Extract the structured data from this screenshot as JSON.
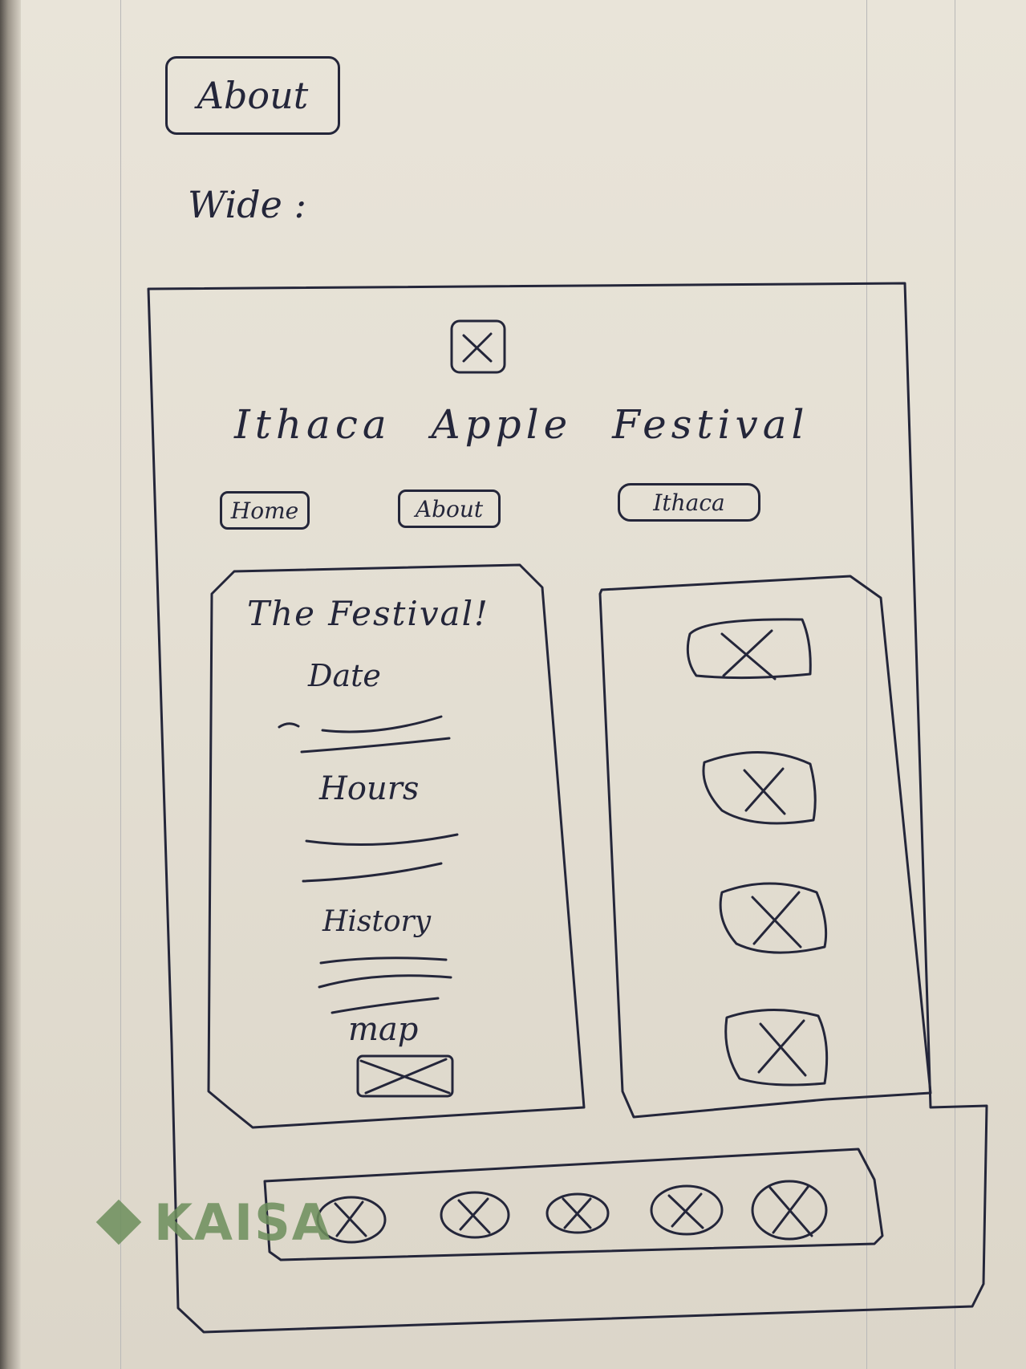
{
  "sketch": {
    "page_label": "About",
    "layout_label": "Wide :",
    "site_title": "Ithaca  Apple  Festival",
    "nav": {
      "home": "Home",
      "about": "About",
      "ithaca": "Ithaca"
    },
    "festival_panel": {
      "heading": "The Festival!",
      "date_label": "Date",
      "hours_label": "Hours",
      "history_label": "History",
      "map_label": "map"
    },
    "watermark": "KAISA"
  },
  "colors": {
    "ink": "#24263a",
    "paper": "#e6e1d6",
    "watermark": "#6d8f5c"
  }
}
